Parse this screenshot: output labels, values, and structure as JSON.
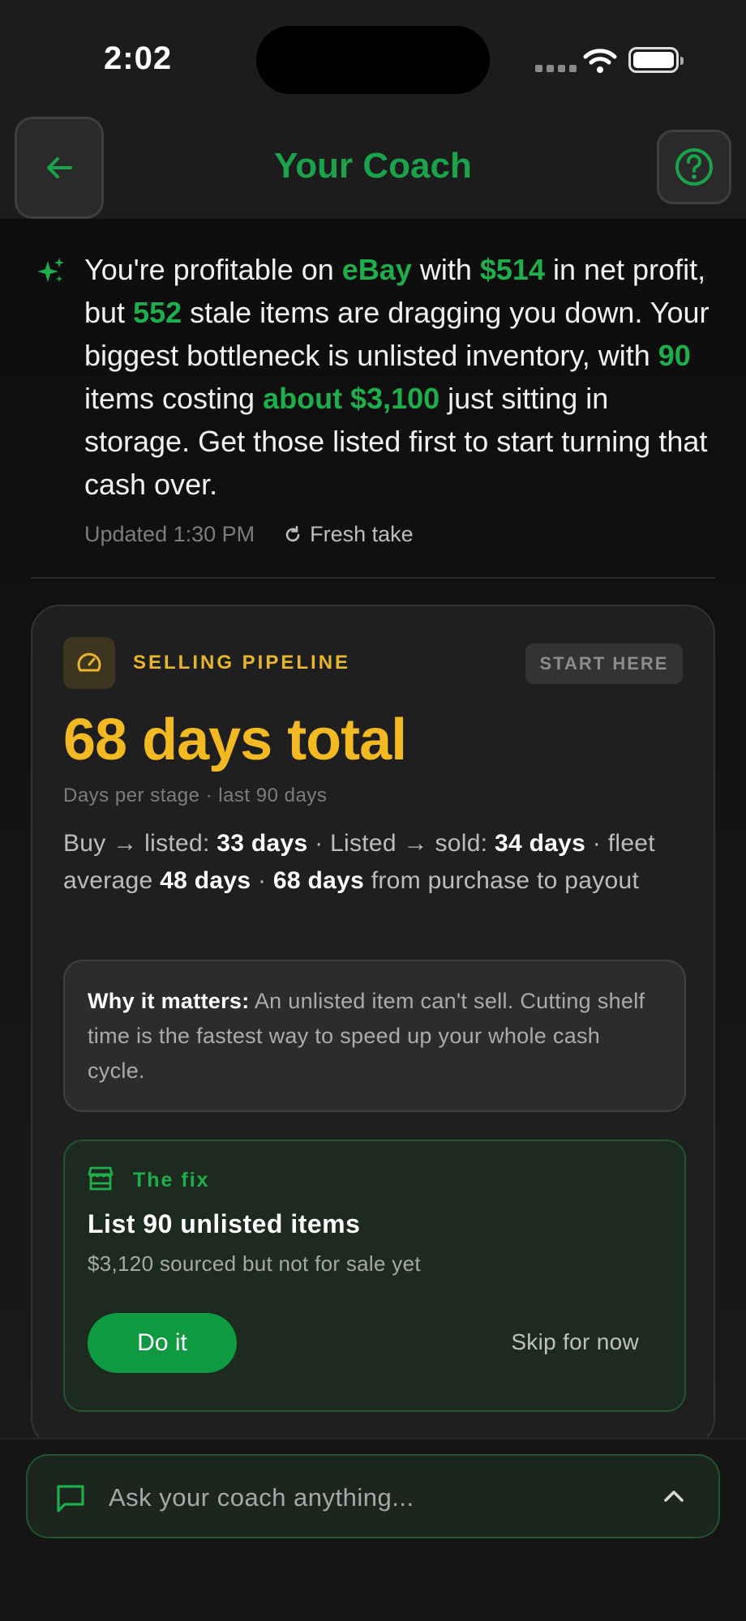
{
  "status_bar": {
    "time": "2:02"
  },
  "header": {
    "title": "Your Coach"
  },
  "summary": {
    "parts": [
      {
        "text": "You're profitable on ",
        "hl": false
      },
      {
        "text": "eBay",
        "hl": true
      },
      {
        "text": " with ",
        "hl": false
      },
      {
        "text": "$514",
        "hl": true
      },
      {
        "text": " in net profit, but ",
        "hl": false
      },
      {
        "text": "552",
        "hl": true
      },
      {
        "text": " stale items are dragging you down. Your biggest bottleneck is unlisted inventory, with ",
        "hl": false
      },
      {
        "text": "90",
        "hl": true
      },
      {
        "text": " items costing ",
        "hl": false
      },
      {
        "text": "about $3,100",
        "hl": true
      },
      {
        "text": " just sitting in storage. Get those listed first to start turning that cash over.",
        "hl": false
      }
    ],
    "updated": "Updated 1:30 PM",
    "refresh_label": "Fresh take"
  },
  "card": {
    "eyebrow": "SELLING PIPELINE",
    "badge": "START HERE",
    "metric": "68 days total",
    "metric_sub": "Days per stage · last 90 days",
    "breakdown": {
      "t1": "Buy → listed: ",
      "v1": "33 days",
      "t2": " · Listed → sold: ",
      "v2": "34 days",
      "t3": " · fleet average ",
      "v3": "48 days",
      "t4": " · ",
      "v4": "68 days",
      "t5": " from purchase to payout"
    },
    "why": {
      "label": "Why it matters:",
      "text": " An unlisted item can't sell. Cutting shelf time is the fastest way to speed up your whole cash cycle."
    },
    "fix": {
      "label": "The fix",
      "title": "List 90 unlisted items",
      "subtitle": "$3,120 sourced but not for sale yet",
      "primary": "Do it",
      "secondary": "Skip for now"
    }
  },
  "chat": {
    "placeholder": "Ask your coach anything..."
  },
  "colors": {
    "accent_green": "#1fae4c",
    "accent_yellow": "#f3b923",
    "background": "#151515"
  }
}
